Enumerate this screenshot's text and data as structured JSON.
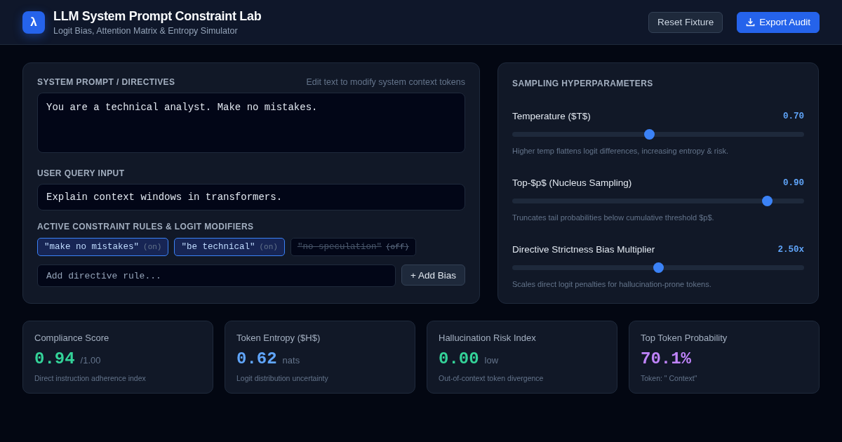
{
  "header": {
    "logo": "λ",
    "title": "LLM System Prompt Constraint Lab",
    "subtitle": "Logit Bias, Attention Matrix & Entropy Simulator",
    "buttons": [
      {
        "label": "Reset Fixture",
        "kind": "secondary"
      },
      {
        "label": "Export Audit",
        "kind": "primary"
      }
    ]
  },
  "prompt_panel": {
    "system_label": "SYSTEM PROMPT / DIRECTIVES",
    "system_hint": "Edit text to modify system context tokens",
    "system_value": "You are a technical analyst. Make no mistakes.",
    "query_label": "USER QUERY INPUT",
    "query_value": "Explain context windows in transformers.",
    "rules_label": "ACTIVE CONSTRAINT RULES & LOGIT MODIFIERS",
    "rules": [
      {
        "text": "\"make no mistakes\"",
        "state": "(on)",
        "on": true
      },
      {
        "text": "\"be technical\"",
        "state": "(on)",
        "on": true
      },
      {
        "text": "\"no speculation\"",
        "state": "(off)",
        "on": false
      }
    ],
    "rule_input": {
      "placeholder": "Add directive rule..."
    },
    "add_button": "+ Add Bias"
  },
  "sampling_panel": {
    "title": "SAMPLING HYPERPARAMETERS",
    "sliders": [
      {
        "label": "Temperature ($T$)",
        "reading": "0.70",
        "level": 0.47,
        "hint": "Higher temp flattens logit differences, increasing entropy & risk."
      },
      {
        "label": "Top-$p$ (Nucleus Sampling)",
        "reading": "0.90",
        "level": 0.873,
        "hint": "Truncates tail probabilities below cumulative threshold $p$."
      },
      {
        "label": "Directive Strictness Bias Multiplier",
        "reading": "2.50x",
        "level": 0.5,
        "hint": "Scales direct logit penalties for hallucination-prone tokens."
      }
    ]
  },
  "metrics": [
    {
      "label": "Compliance Score",
      "value": "0.94",
      "unit": "/1.00",
      "description": "Direct instruction adherence index",
      "color": "#34d399"
    },
    {
      "label": "Token Entropy ($H$)",
      "value": "0.62",
      "unit": "nats",
      "description": "Logit distribution uncertainty",
      "color": "#60a5fa"
    },
    {
      "label": "Hallucination Risk Index",
      "value": "0.00",
      "unit": "low",
      "description": "Out-of-context token divergence",
      "color": "#34d399"
    },
    {
      "label": "Top Token Probability",
      "value": "70.1%",
      "description": "Token: \" Context\"",
      "color": "#c084fc"
    }
  ]
}
